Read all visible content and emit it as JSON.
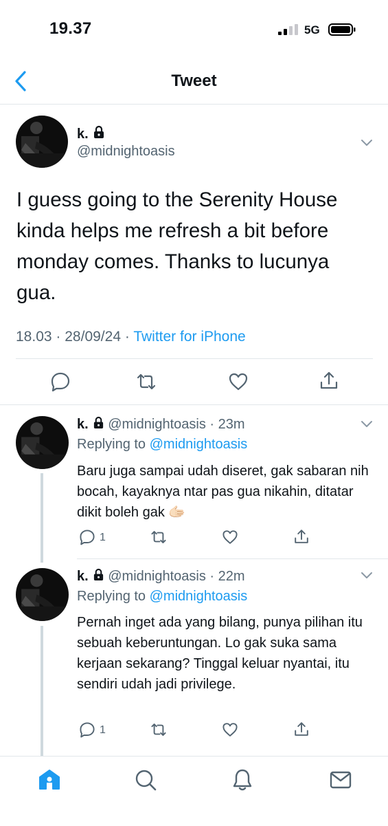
{
  "status_bar": {
    "time": "19.37",
    "network": "5G"
  },
  "header": {
    "title": "Tweet"
  },
  "main_tweet": {
    "name": "k.",
    "handle": "@midnightoasis",
    "text": "I guess going to the Serenity House kinda helps me refresh a bit before monday comes. Thanks to lucunya gua.",
    "time": "18.03",
    "date": "28/09/24",
    "separator": "·",
    "source": "Twitter for iPhone"
  },
  "replies": [
    {
      "name": "k.",
      "handle": "@midnightoasis",
      "time": "· 23m",
      "replying_prefix": "Replying to",
      "replying_handle": "@midnightoasis",
      "text": "Baru juga sampai udah diseret, gak sabaran nih bocah, kayaknya ntar pas gua nikahin, ditatar dikit boleh gak 🫱🏻",
      "reply_count": "1"
    },
    {
      "name": "k.",
      "handle": "@midnightoasis",
      "time": "· 22m",
      "replying_prefix": "Replying to",
      "replying_handle": "@midnightoasis",
      "text": "Pernah inget ada yang bilang, punya pilihan itu sebuah keberuntungan. Lo gak suka sama kerjaan sekarang? Tinggal keluar nyantai, itu sendiri udah jadi privilege.",
      "reply_count": "1"
    }
  ],
  "tabs": [
    "home-icon",
    "search-icon",
    "notifications-icon",
    "messages-icon"
  ],
  "colors": {
    "accent": "#1d9bf0",
    "secondary_text": "#536471",
    "divider": "#e1e6ea",
    "thread_line": "#cfd9de"
  }
}
